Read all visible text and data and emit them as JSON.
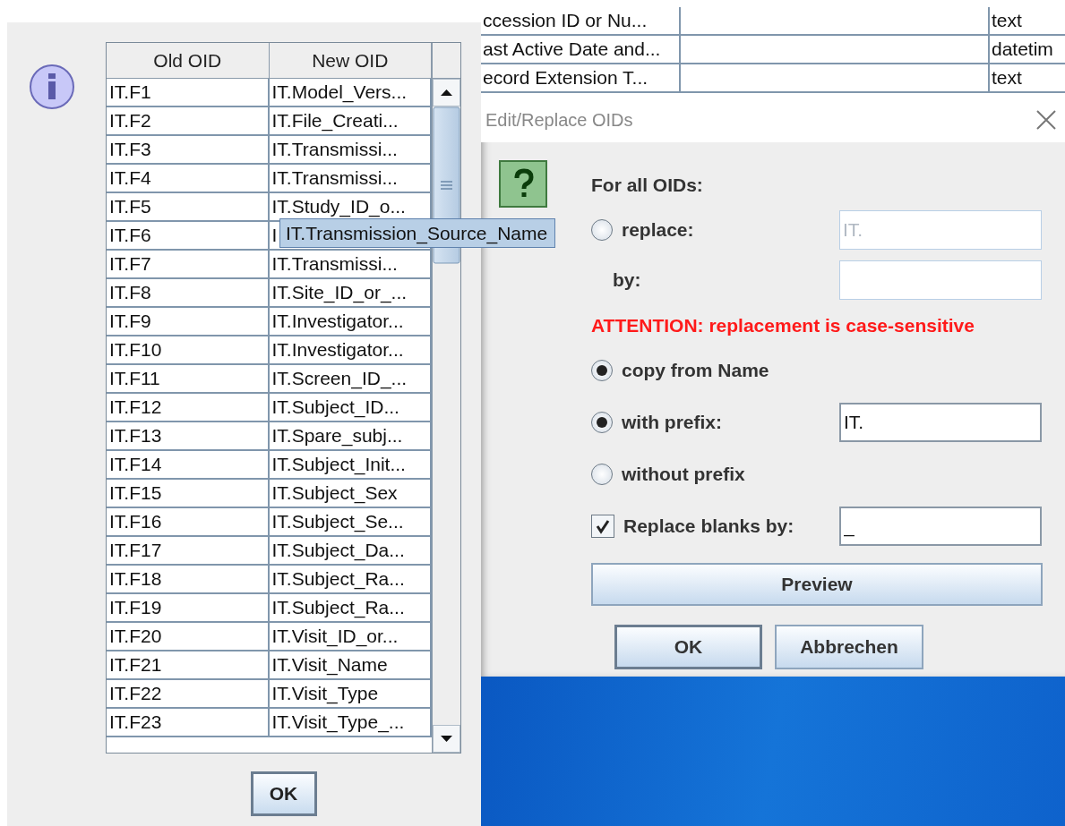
{
  "info_dialog": {
    "table": {
      "columns": [
        "Old OID",
        "New OID"
      ],
      "rows": [
        {
          "old": "IT.F1",
          "new": "IT.Model_Vers..."
        },
        {
          "old": "IT.F2",
          "new": "IT.File_Creati..."
        },
        {
          "old": "IT.F3",
          "new": "IT.Transmissi..."
        },
        {
          "old": "IT.F4",
          "new": "IT.Transmissi..."
        },
        {
          "old": "IT.F5",
          "new": "IT.Study_ID_o..."
        },
        {
          "old": "IT.F6",
          "new": "I"
        },
        {
          "old": "IT.F7",
          "new": "IT.Transmissi..."
        },
        {
          "old": "IT.F8",
          "new": "IT.Site_ID_or_..."
        },
        {
          "old": "IT.F9",
          "new": "IT.Investigator..."
        },
        {
          "old": "IT.F10",
          "new": "IT.Investigator..."
        },
        {
          "old": "IT.F11",
          "new": "IT.Screen_ID_..."
        },
        {
          "old": "IT.F12",
          "new": "IT.Subject_ID..."
        },
        {
          "old": "IT.F13",
          "new": "IT.Spare_subj..."
        },
        {
          "old": "IT.F14",
          "new": "IT.Subject_Init..."
        },
        {
          "old": "IT.F15",
          "new": "IT.Subject_Sex"
        },
        {
          "old": "IT.F16",
          "new": "IT.Subject_Se..."
        },
        {
          "old": "IT.F17",
          "new": "IT.Subject_Da..."
        },
        {
          "old": "IT.F18",
          "new": "IT.Subject_Ra..."
        },
        {
          "old": "IT.F19",
          "new": "IT.Subject_Ra..."
        },
        {
          "old": "IT.F20",
          "new": "IT.Visit_ID_or..."
        },
        {
          "old": "IT.F21",
          "new": "IT.Visit_Name"
        },
        {
          "old": "IT.F22",
          "new": "IT.Visit_Type"
        },
        {
          "old": "IT.F23",
          "new": "IT.Visit_Type_..."
        }
      ]
    },
    "tooltip": "IT.Transmission_Source_Name",
    "ok_button": "OK"
  },
  "background_table": {
    "rows": [
      {
        "column_1": "ccession ID or Nu...",
        "column_3": "text"
      },
      {
        "column_1": "ast Active Date and...",
        "column_3": "datetim"
      },
      {
        "column_1": "ecord Extension T...",
        "column_3": "text"
      }
    ]
  },
  "edit_dialog": {
    "title": "Edit/Replace OIDs",
    "heading": "For all OIDs:",
    "replace": {
      "label": "replace:",
      "selected": false,
      "value": "IT.",
      "disabled": true
    },
    "by": {
      "label": "by:"
    },
    "warning": "ATTENTION: replacement is case-sensitive",
    "options": [
      {
        "label": "copy from Name",
        "selected": true
      },
      {
        "label": "with prefix:",
        "selected": true,
        "value": "IT."
      },
      {
        "label": "without prefix",
        "selected": false
      }
    ],
    "replace_blanks": {
      "label": "Replace blanks by:",
      "checked": true,
      "value": "_"
    },
    "preview_button": "Preview",
    "ok_button": "OK",
    "cancel_button": "Abbrechen"
  }
}
